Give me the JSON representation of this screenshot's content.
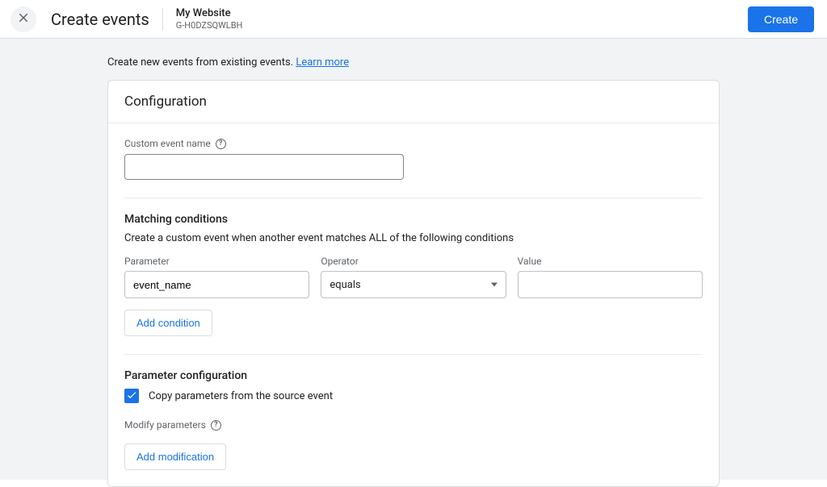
{
  "header": {
    "title": "Create events",
    "websiteName": "My Website",
    "websiteId": "G-H0DZSQWLBH",
    "createBtn": "Create"
  },
  "intro": {
    "text": "Create new events from existing events. ",
    "link": "Learn more"
  },
  "config": {
    "title": "Configuration",
    "customNameLabel": "Custom event name",
    "customNameValue": ""
  },
  "matching": {
    "title": "Matching conditions",
    "desc": "Create a custom event when another event matches ALL of the following conditions",
    "labels": {
      "parameter": "Parameter",
      "operator": "Operator",
      "value": "Value"
    },
    "row": {
      "parameter": "event_name",
      "operator": "equals",
      "value": ""
    },
    "addBtn": "Add condition"
  },
  "paramConfig": {
    "title": "Parameter configuration",
    "copyLabel": "Copy parameters from the source event",
    "copyChecked": true,
    "modifyLabel": "Modify parameters",
    "addModBtn": "Add modification"
  }
}
